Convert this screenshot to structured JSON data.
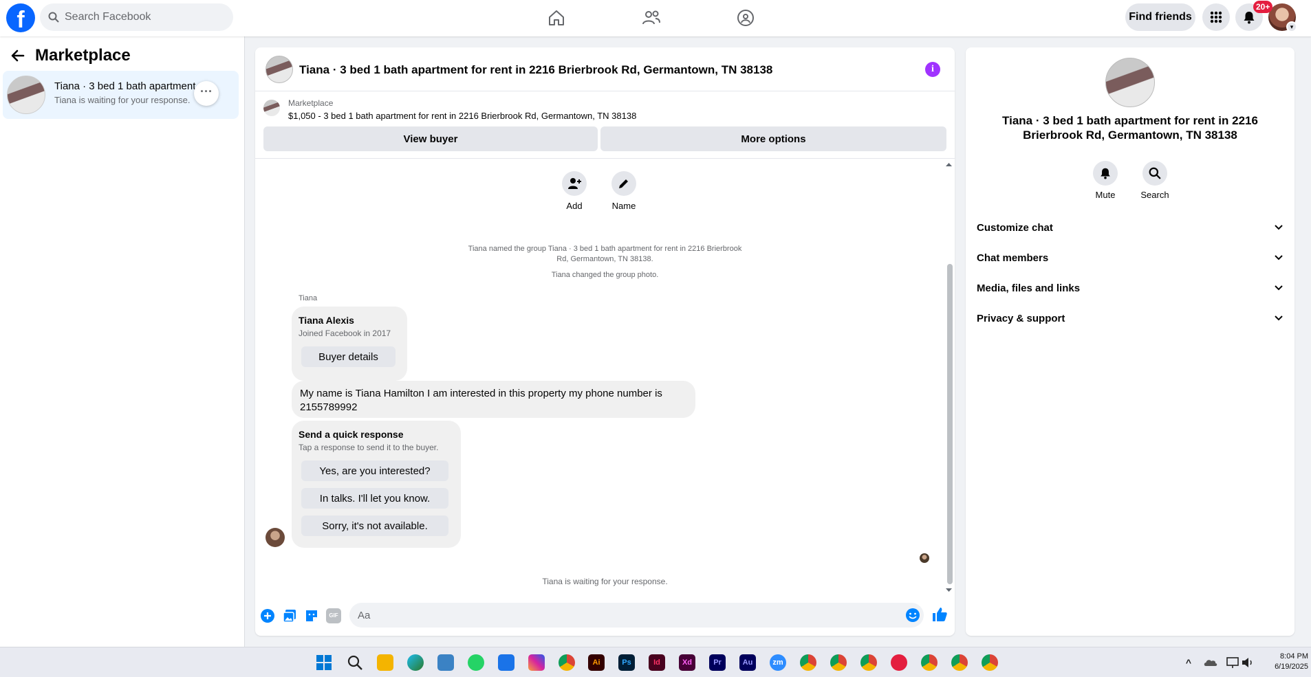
{
  "topbar": {
    "logo_letter": "f",
    "search_placeholder": "Search Facebook",
    "find_friends_label": "Find friends",
    "notifications_badge": "20+"
  },
  "left_panel": {
    "title": "Marketplace",
    "conversation": {
      "name": "Tiana · 3 bed 1 bath apartment ...",
      "subtitle": "Tiana is waiting for your response. · 4"
    }
  },
  "chat": {
    "header_title": "Tiana · 3 bed 1 bath apartment for rent in 2216 Brierbrook Rd, Germantown, TN 38138",
    "listing_category": "Marketplace",
    "listing_price_line": "$1,050 - 3 bed 1 bath apartment for rent in 2216 Brierbrook Rd, Germantown, TN 38138",
    "view_buyer_label": "View buyer",
    "more_options_label": "More options",
    "add_label": "Add",
    "name_label": "Name",
    "system_msg_1_line1": "Tiana named the group Tiana · 3 bed 1 bath apartment for rent in 2216 Brierbrook",
    "system_msg_1_line2": "Rd, Germantown, TN 38138.",
    "system_msg_2": "Tiana changed the group photo.",
    "sender_name": "Tiana",
    "buyer_card": {
      "name": "Tiana Alexis",
      "joined": "Joined Facebook in 2017",
      "button_label": "Buyer details"
    },
    "message_text": "My name is Tiana Hamilton I am interested in this property my phone number is 2155789992",
    "quick_response": {
      "title": "Send a quick response",
      "subtitle": "Tap a response to send it to the buyer.",
      "options": [
        "Yes, are you interested?",
        "In talks. I'll let you know.",
        "Sorry, it's not available."
      ]
    },
    "status_text": "Tiana is waiting for your response.",
    "composer_placeholder": "Aa",
    "gif_label": "GIF"
  },
  "right_panel": {
    "title": "Tiana · 3 bed 1 bath apartment for rent in 2216 Brierbrook Rd, Germantown, TN 38138",
    "mute_label": "Mute",
    "search_label": "Search",
    "sections": [
      "Customize chat",
      "Chat members",
      "Media, files and links",
      "Privacy & support"
    ]
  },
  "taskbar": {
    "time": "8:04 PM",
    "date": "6/19/2025",
    "app_labels": [
      "Ai",
      "Ps",
      "Id",
      "Xd",
      "Pr",
      "Au",
      "zm"
    ]
  },
  "colors": {
    "facebook_blue": "#0866ff",
    "messenger_blue": "#0084ff",
    "info_purple": "#a033ff",
    "badge_red": "#e41e3f"
  },
  "icons": [
    "search-icon",
    "home-icon",
    "friends-icon",
    "groups-icon",
    "menu-grid-icon",
    "bell-icon",
    "back-arrow-icon",
    "info-icon",
    "add-person-icon",
    "pencil-icon",
    "plus-icon",
    "photo-icon",
    "sticker-icon",
    "gif-icon",
    "emoji-icon",
    "thumbs-up-icon",
    "chevron-down-icon"
  ]
}
